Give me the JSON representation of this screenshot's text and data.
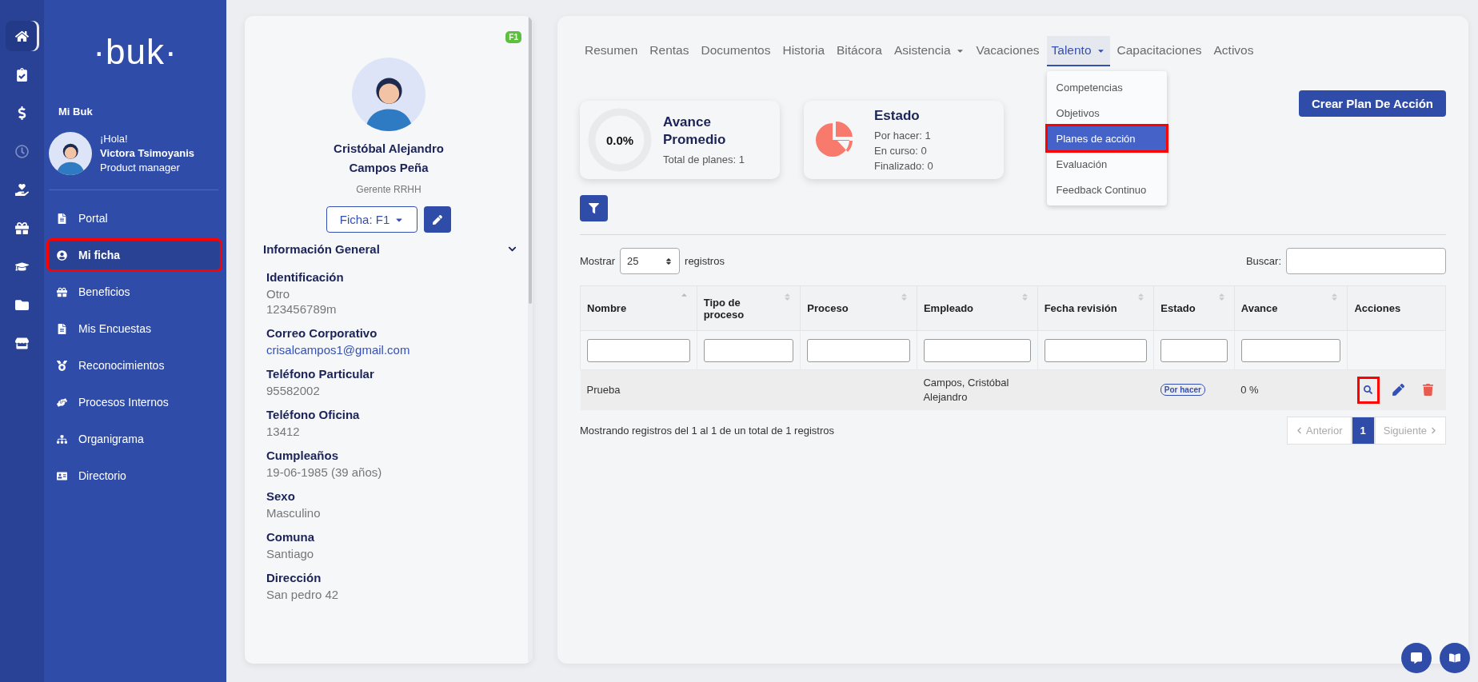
{
  "rail": [
    {
      "kind": "home",
      "selected": true,
      "disabled": false
    },
    {
      "kind": "clipboard",
      "selected": false,
      "disabled": false
    },
    {
      "kind": "dollar",
      "selected": false,
      "disabled": false
    },
    {
      "kind": "clock",
      "selected": false,
      "disabled": true
    },
    {
      "kind": "hand",
      "selected": false,
      "disabled": false
    },
    {
      "kind": "gift",
      "selected": false,
      "disabled": false
    },
    {
      "kind": "cap",
      "selected": false,
      "disabled": false
    },
    {
      "kind": "folder",
      "selected": false,
      "disabled": false
    },
    {
      "kind": "store",
      "selected": false,
      "disabled": false
    }
  ],
  "sidebar": {
    "logo": "·buk·",
    "section_title": "Mi Buk",
    "user": {
      "greeting": "¡Hola!",
      "name": "Victora Tsimoyanis",
      "role": "Product manager"
    },
    "items": [
      {
        "label": "Portal",
        "kind": "file",
        "selected": false,
        "highlighted": false
      },
      {
        "label": "Mi ficha",
        "kind": "user",
        "selected": true,
        "highlighted": true
      },
      {
        "label": "Beneficios",
        "kind": "gift",
        "selected": false,
        "highlighted": false
      },
      {
        "label": "Mis Encuestas",
        "kind": "file",
        "selected": false,
        "highlighted": false
      },
      {
        "label": "Reconocimientos",
        "kind": "medal",
        "selected": false,
        "highlighted": false
      },
      {
        "label": "Procesos Internos",
        "kind": "hand",
        "selected": false,
        "highlighted": false
      },
      {
        "label": "Organigrama",
        "kind": "sitemap",
        "selected": false,
        "highlighted": false
      },
      {
        "label": "Directorio",
        "kind": "card",
        "selected": false,
        "highlighted": false
      }
    ]
  },
  "profile": {
    "badge": "F1",
    "name": "Cristóbal Alejandro Campos Peña",
    "role": "Gerente RRHH",
    "ficha_button": "Ficha: F1",
    "section": {
      "title": "Información General",
      "expanded": true
    },
    "fields": [
      {
        "label": "Identificación",
        "values": [
          "Otro",
          "123456789m"
        ],
        "kind": "text"
      },
      {
        "label": "Correo Corporativo",
        "values": [
          "crisalcampos1@gmail.com"
        ],
        "kind": "link"
      },
      {
        "label": "Teléfono Particular",
        "values": [
          "95582002"
        ],
        "kind": "text"
      },
      {
        "label": "Teléfono Oficina",
        "values": [
          "13412"
        ],
        "kind": "text"
      },
      {
        "label": "Cumpleaños",
        "values": [
          "19-06-1985 (39 años)"
        ],
        "kind": "text"
      },
      {
        "label": "Sexo",
        "values": [
          "Masculino"
        ],
        "kind": "text"
      },
      {
        "label": "Comuna",
        "values": [
          "Santiago"
        ],
        "kind": "text"
      },
      {
        "label": "Dirección",
        "values": [
          "San pedro 42"
        ],
        "kind": "text"
      }
    ]
  },
  "tabs": [
    {
      "label": "Resumen",
      "selected": false,
      "dropdown": false
    },
    {
      "label": "Rentas",
      "selected": false,
      "dropdown": false
    },
    {
      "label": "Documentos",
      "selected": false,
      "dropdown": false
    },
    {
      "label": "Historia",
      "selected": false,
      "dropdown": false
    },
    {
      "label": "Bitácora",
      "selected": false,
      "dropdown": false
    },
    {
      "label": "Asistencia",
      "selected": false,
      "dropdown": true
    },
    {
      "label": "Vacaciones",
      "selected": false,
      "dropdown": false
    },
    {
      "label": "Talento",
      "selected": true,
      "dropdown": true
    },
    {
      "label": "Capacitaciones",
      "selected": false,
      "dropdown": false
    },
    {
      "label": "Activos",
      "selected": false,
      "dropdown": false
    }
  ],
  "talent_menu": [
    {
      "label": "Competencias",
      "selected": false,
      "highlighted": false
    },
    {
      "label": "Objetivos",
      "selected": false,
      "highlighted": false
    },
    {
      "label": "Planes de acción",
      "selected": true,
      "highlighted": true
    },
    {
      "label": "Evaluación",
      "selected": false,
      "highlighted": false
    },
    {
      "label": "Feedback Continuo",
      "selected": false,
      "highlighted": false
    }
  ],
  "create_button": "Crear Plan De Acción",
  "progress_card": {
    "value": "0.0%",
    "title": "Avance Promedio",
    "lines": [
      "Total de planes: 1"
    ]
  },
  "status_card": {
    "title": "Estado",
    "lines": [
      "Por hacer: 1",
      "En curso: 0",
      "Finalizado: 0"
    ]
  },
  "table_controls": {
    "show_label": "Mostrar",
    "page_size": "25",
    "records_label": "registros",
    "search_label": "Buscar:"
  },
  "table": {
    "columns": [
      {
        "label": "Nombre",
        "sortable": true,
        "sorted": true
      },
      {
        "label": "Tipo de proceso",
        "sortable": true,
        "sorted": false
      },
      {
        "label": "Proceso",
        "sortable": true,
        "sorted": false
      },
      {
        "label": "Empleado",
        "sortable": true,
        "sorted": false
      },
      {
        "label": "Fecha revisión",
        "sortable": true,
        "sorted": false
      },
      {
        "label": "Estado",
        "sortable": true,
        "sorted": false
      },
      {
        "label": "Avance",
        "sortable": true,
        "sorted": false
      },
      {
        "label": "Acciones",
        "sortable": false
      }
    ],
    "rows": [
      {
        "nombre": "Prueba",
        "tipo": "",
        "proceso": "",
        "empleado": "Campos, Cristóbal Alejandro",
        "fecha": "",
        "estado": "Por hacer",
        "avance": "0 %",
        "actions": [
          {
            "kind": "view",
            "highlighted": true
          },
          {
            "kind": "edit",
            "highlighted": false
          },
          {
            "kind": "delete",
            "highlighted": false
          }
        ]
      }
    ]
  },
  "footer": {
    "info": "Mostrando registros del 1 al 1 de un total de 1 registros",
    "pages": [
      {
        "label": "Anterior",
        "kind": "prev",
        "selected": false,
        "disabled": true
      },
      {
        "label": "1",
        "kind": "page",
        "selected": true,
        "disabled": false
      },
      {
        "label": "Siguiente",
        "kind": "next",
        "selected": false,
        "disabled": true
      }
    ]
  }
}
